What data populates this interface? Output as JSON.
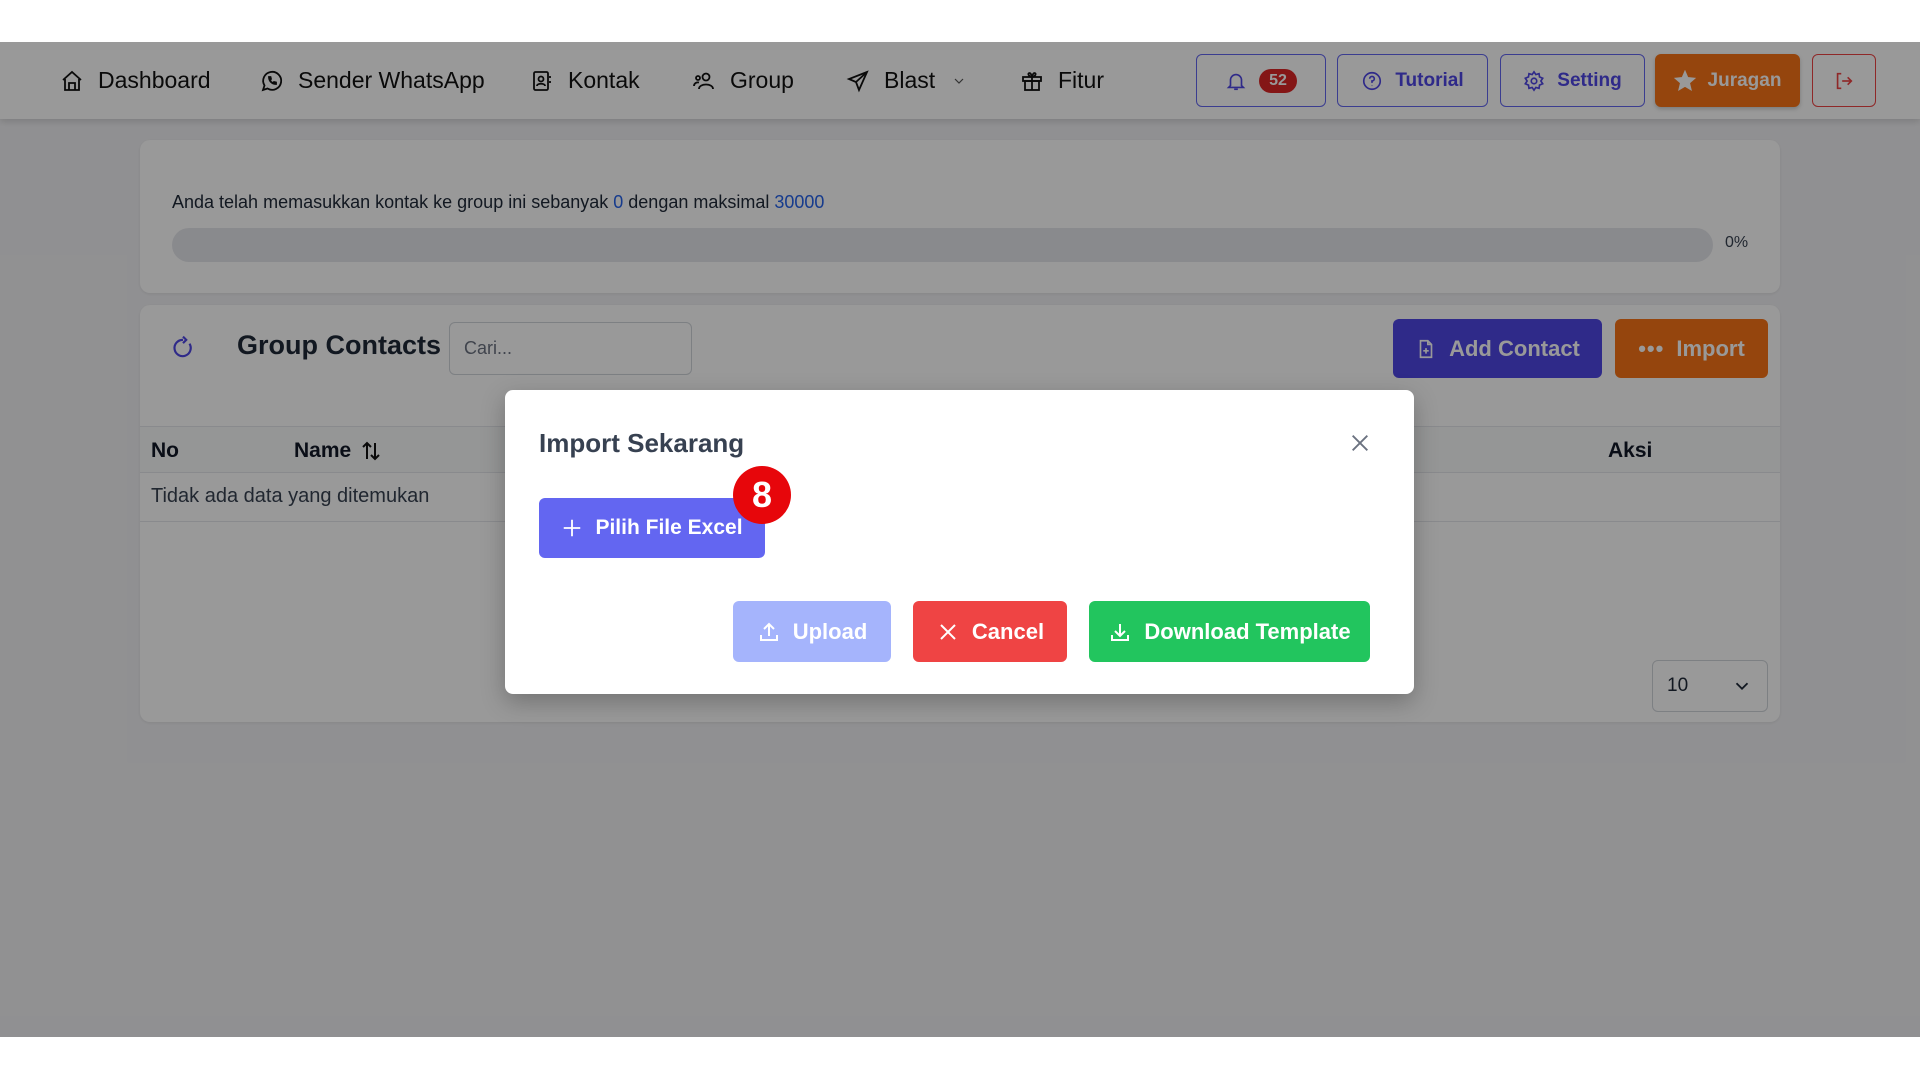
{
  "navbar": {
    "items": [
      {
        "label": "Dashboard",
        "icon": "home-icon"
      },
      {
        "label": "Sender WhatsApp",
        "icon": "whatsapp-icon"
      },
      {
        "label": "Kontak",
        "icon": "contact-book-icon"
      },
      {
        "label": "Group",
        "icon": "users-icon"
      },
      {
        "label": "Blast",
        "icon": "send-icon"
      },
      {
        "label": "Fitur",
        "icon": "gift-icon"
      }
    ],
    "notification_count": "52",
    "tutorial_label": "Tutorial",
    "setting_label": "Setting",
    "juragan_label": "Juragan"
  },
  "quota": {
    "text_before": "Anda telah memasukkan kontak ke group ini sebanyak ",
    "current": "0",
    "text_middle": " dengan maksimal ",
    "max": "30000",
    "progress_percent": 0,
    "progress_label": "0%"
  },
  "contacts": {
    "title": "Group Contacts",
    "search_placeholder": "Cari...",
    "add_contact_label": "Add Contact",
    "import_label": "Import",
    "columns": {
      "no": "No",
      "name": "Name",
      "aksi": "Aksi"
    },
    "empty_message": "Tidak ada data yang ditemukan",
    "per_page": "10"
  },
  "modal": {
    "title": "Import Sekarang",
    "pick_file_label": "Pilih File Excel",
    "step_badge": "8",
    "upload_label": "Upload",
    "cancel_label": "Cancel",
    "download_label": "Download Template"
  }
}
